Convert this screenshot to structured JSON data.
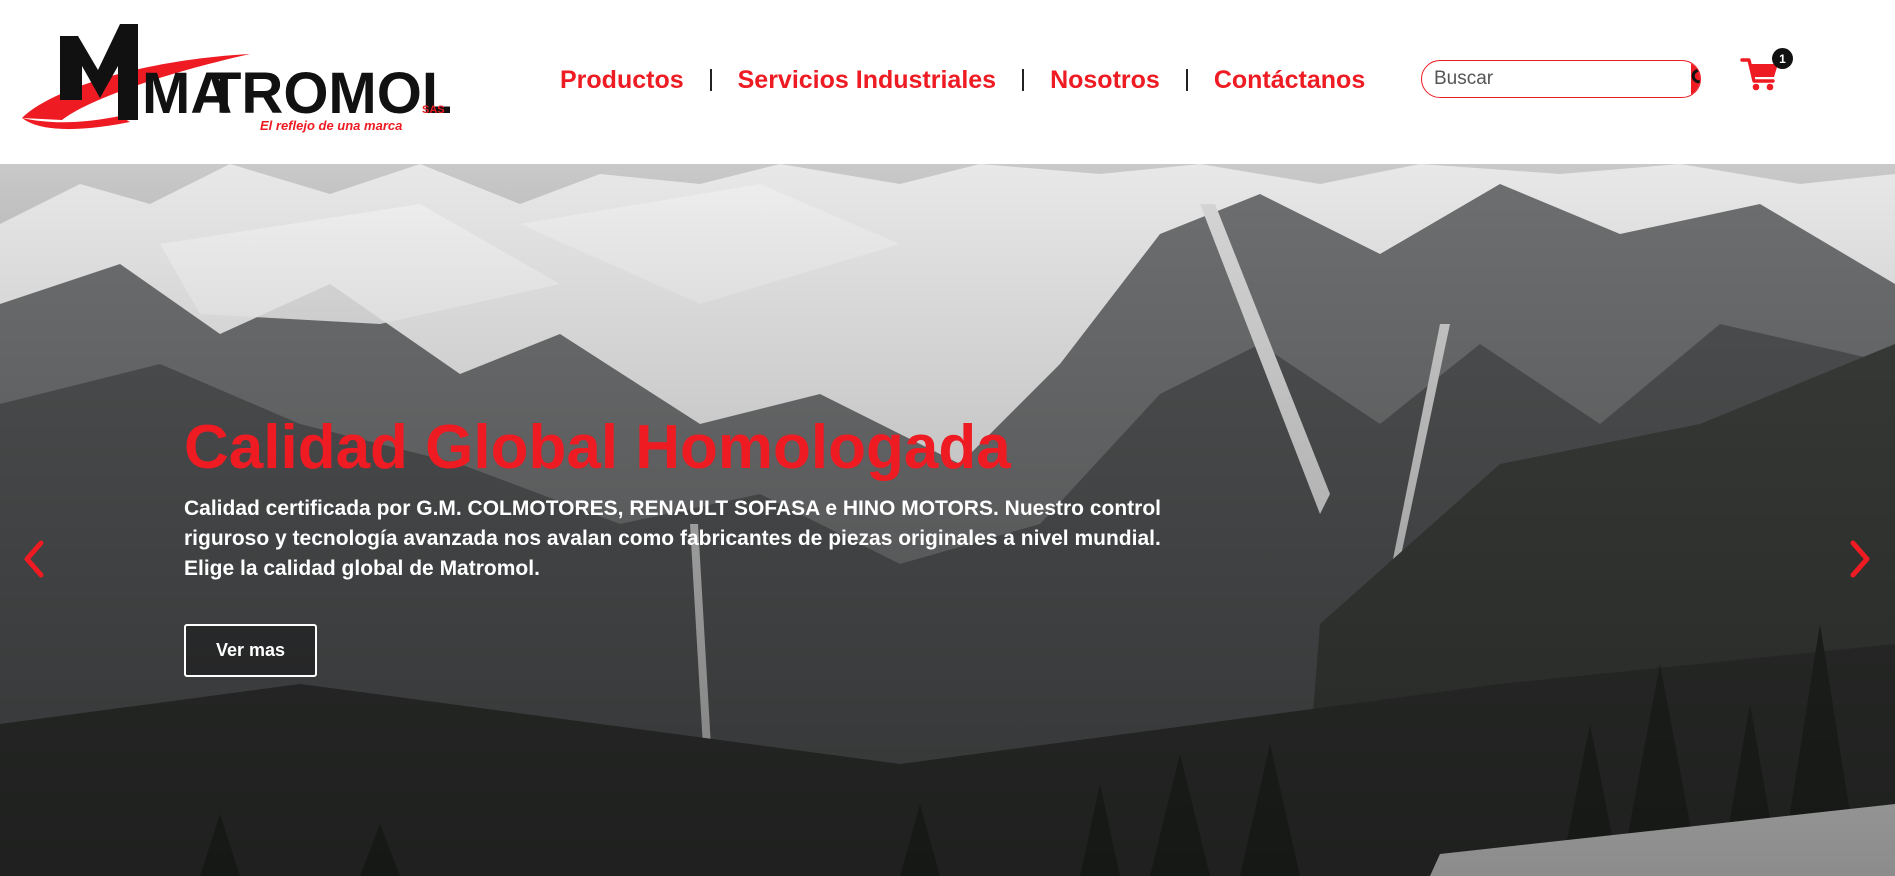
{
  "brand": {
    "name_part1": "MA",
    "name_part2": "TROMOL",
    "suffix": "SAS",
    "tagline": "El reflejo de una marca",
    "accent_color": "#ee1b23"
  },
  "nav": {
    "items": [
      {
        "label": "Productos"
      },
      {
        "label": "Servicios Industriales"
      },
      {
        "label": "Nosotros"
      },
      {
        "label": "Contáctanos"
      }
    ]
  },
  "search": {
    "placeholder": "Buscar",
    "value": "",
    "icon": "search-icon"
  },
  "cart": {
    "icon": "shopping-cart-icon",
    "count": "1"
  },
  "hero": {
    "title": "Calidad Global Homologada",
    "text": "Calidad certificada por G.M. COLMOTORES, RENAULT SOFASA e HINO MOTORS. Nuestro control riguroso y tecnología avanzada nos avalan como fabricantes de piezas originales a nivel mundial. Elige la calidad global de Matromol.",
    "button_label": "Ver mas",
    "prev_icon": "chevron-left-icon",
    "next_icon": "chevron-right-icon"
  }
}
